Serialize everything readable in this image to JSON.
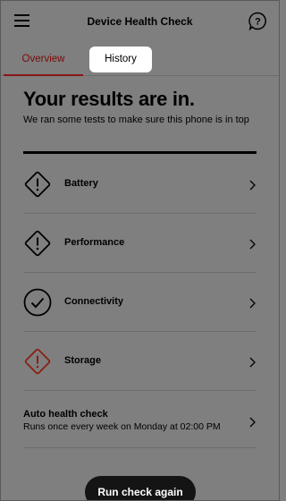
{
  "header": {
    "title": "Device Health Check"
  },
  "tabs": [
    {
      "label": "Overview",
      "active": true
    },
    {
      "label": "History",
      "active": false
    }
  ],
  "results": {
    "title": "Your results are in.",
    "subtitle": "We ran some tests to make sure this phone is in top"
  },
  "checks": [
    {
      "label": "Battery",
      "icon": "warning-diamond-icon",
      "status_color": "#000000"
    },
    {
      "label": "Performance",
      "icon": "warning-diamond-icon",
      "status_color": "#000000"
    },
    {
      "label": "Connectivity",
      "icon": "check-circle-icon",
      "status_color": "#000000"
    },
    {
      "label": "Storage",
      "icon": "warning-diamond-icon",
      "status_color": "#8a1f10"
    }
  ],
  "auto_check": {
    "title": "Auto health check",
    "subtitle": "Runs once every week on Monday at 02:00 PM"
  },
  "actions": {
    "run_again": "Run check again"
  },
  "colors": {
    "accent": "#8a1515",
    "overlay_background": "#7f7f7f"
  }
}
